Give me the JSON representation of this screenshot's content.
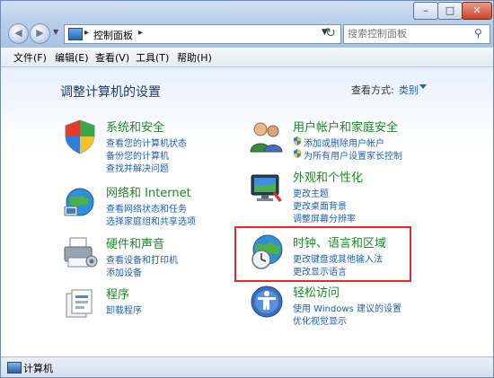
{
  "window": {
    "minimize": "–",
    "maximize": "□",
    "close": "✕"
  },
  "nav": {
    "back": "◀",
    "forward": "▶",
    "dropdown": "▼"
  },
  "address": {
    "separator": "▸",
    "crumb": "控制面板",
    "separator2": "▸",
    "dropdown": "▼",
    "refresh": "↻"
  },
  "search": {
    "placeholder": "搜索控制面板",
    "icon": "⚲"
  },
  "menu": [
    "文件(F)",
    "编辑(E)",
    "查看(V)",
    "工具(T)",
    "帮助(H)"
  ],
  "page": {
    "title": "调整计算机的设置",
    "view_by_label": "查看方式:",
    "view_by_value": "类别"
  },
  "categories": {
    "system": {
      "title": "系统和安全",
      "links": [
        "查看您的计算机状态",
        "备份您的计算机",
        "查找并解决问题"
      ]
    },
    "network": {
      "title": "网络和 Internet",
      "links": [
        "查看网络状态和任务",
        "选择家庭组和共享选项"
      ]
    },
    "hardware": {
      "title": "硬件和声音",
      "links": [
        "查看设备和打印机",
        "添加设备"
      ]
    },
    "programs": {
      "title": "程序",
      "links": [
        "卸载程序"
      ]
    },
    "users": {
      "title": "用户帐户和家庭安全",
      "links": [
        "添加或删除用户帐户",
        "为所有用户设置家长控制"
      ]
    },
    "appearance": {
      "title": "外观和个性化",
      "links": [
        "更改主题",
        "更改桌面背景",
        "调整屏幕分辨率"
      ]
    },
    "clock": {
      "title": "时钟、语言和区域",
      "links": [
        "更改键盘或其他输入法",
        "更改显示语言"
      ]
    },
    "ease": {
      "title": "轻松访问",
      "links": [
        "使用 Windows 建议的设置",
        "优化视觉显示"
      ]
    }
  },
  "status": {
    "text": "计算机"
  }
}
